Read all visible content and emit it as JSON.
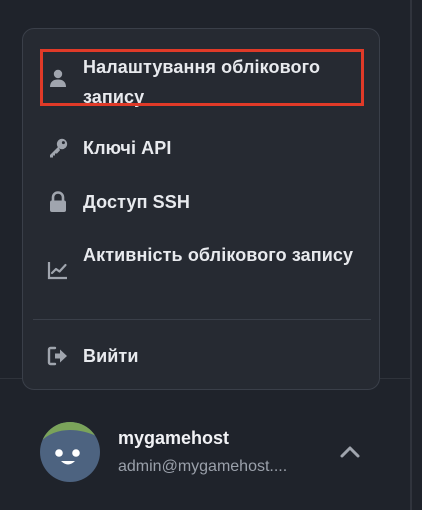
{
  "menu": {
    "items": [
      {
        "label": "Налаштування облікового запису",
        "icon": "user-icon",
        "highlighted": true
      },
      {
        "label": "Ключі API",
        "icon": "key-icon"
      },
      {
        "label": "Доступ SSH",
        "icon": "lock-icon"
      },
      {
        "label": "Активність облікового запису",
        "icon": "chart-line-icon"
      },
      {
        "label": "Вийти",
        "icon": "sign-out-icon"
      }
    ]
  },
  "user": {
    "name": "mygamehost",
    "email": "admin@mygamehost...."
  },
  "colors": {
    "background": "#1f232b",
    "menu_background": "#262a32",
    "highlight": "#e03a28",
    "icon": "#a0a5ae",
    "text": "#e8eaee",
    "avatar_blue": "#4d6380",
    "avatar_green": "#7aa35a"
  }
}
